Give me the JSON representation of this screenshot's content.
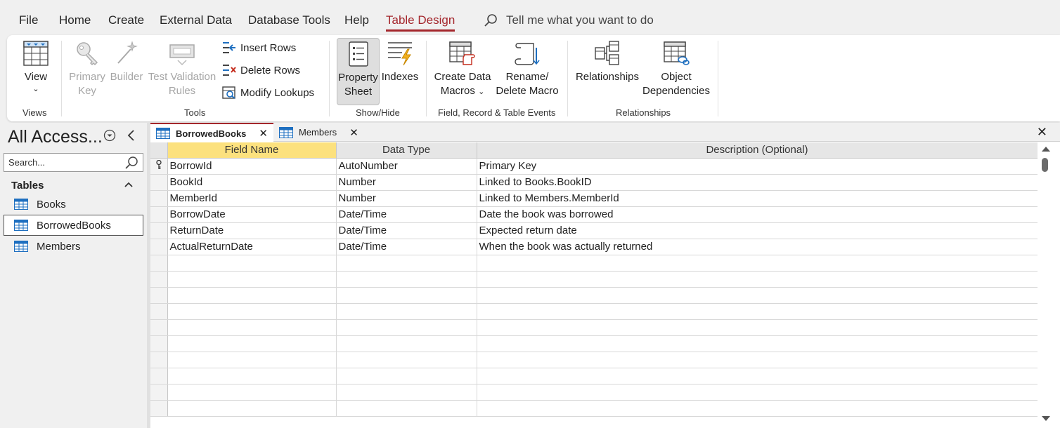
{
  "menu": {
    "tabs": [
      {
        "label": "File"
      },
      {
        "label": "Home"
      },
      {
        "label": "Create"
      },
      {
        "label": "External Data"
      },
      {
        "label": "Database Tools"
      },
      {
        "label": "Help"
      },
      {
        "label": "Table Design",
        "active": true
      }
    ],
    "tell_me": "Tell me what you want to do"
  },
  "ribbon": {
    "views": {
      "view_label": "View",
      "group_label": "Views"
    },
    "tools": {
      "primary_key_1": "Primary",
      "primary_key_2": "Key",
      "builder": "Builder",
      "test_validation_1": "Test Validation",
      "test_validation_2": "Rules",
      "insert_rows": "Insert Rows",
      "delete_rows": "Delete Rows",
      "modify_lookups": "Modify Lookups",
      "group_label": "Tools"
    },
    "show_hide": {
      "property_sheet_1": "Property",
      "property_sheet_2": "Sheet",
      "indexes": "Indexes",
      "group_label": "Show/Hide"
    },
    "events": {
      "create_macros_1": "Create Data",
      "create_macros_2": "Macros",
      "rename_macro_1": "Rename/",
      "rename_macro_2": "Delete Macro",
      "group_label": "Field, Record & Table Events"
    },
    "relationships": {
      "relationships": "Relationships",
      "object_dep_1": "Object",
      "object_dep_2": "Dependencies",
      "group_label": "Relationships"
    }
  },
  "nav": {
    "title": "All Access...",
    "search_placeholder": "Search...",
    "group": "Tables",
    "items": [
      {
        "label": "Books"
      },
      {
        "label": "BorrowedBooks",
        "selected": true
      },
      {
        "label": "Members"
      }
    ]
  },
  "doc_tabs": [
    {
      "label": "BorrowedBooks",
      "active": true
    },
    {
      "label": "Members"
    }
  ],
  "grid": {
    "headers": {
      "field": "Field Name",
      "type": "Data Type",
      "desc": "Description (Optional)"
    },
    "rows": [
      {
        "field": "BorrowId",
        "type": "AutoNumber",
        "desc": "Primary Key",
        "key": true
      },
      {
        "field": "BookId",
        "type": "Number",
        "desc": "Linked to Books.BookID"
      },
      {
        "field": "MemberId",
        "type": "Number",
        "desc": "Linked to Members.MemberId"
      },
      {
        "field": "BorrowDate",
        "type": "Date/Time",
        "desc": "Date the book was borrowed"
      },
      {
        "field": "ReturnDate",
        "type": "Date/Time",
        "desc": "Expected return date"
      },
      {
        "field": "ActualReturnDate",
        "type": "Date/Time",
        "desc": "When the book was actually returned"
      }
    ],
    "empty_rows": 10
  },
  "colors": {
    "accent": "#a4262c",
    "header_highlight": "#fce17e"
  }
}
